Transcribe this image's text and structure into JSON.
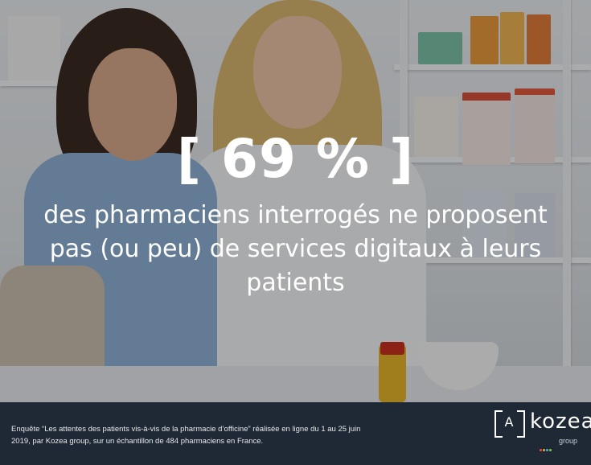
{
  "headline": {
    "stat": "[ 69 % ]",
    "line1": "des pharmaciens interrogés ne proposent",
    "line2": "pas (ou peu) de services digitaux à leurs",
    "line3": "patients"
  },
  "footer": {
    "note_line1": "Enquête “Les attentes des patients vis-à-vis de la pharmacie d’officine” réalisée en ligne du 1 au 25 juin",
    "note_line2": "2019, par Kozea group, sur un échantillon de 484 pharmaciens en France."
  },
  "logo": {
    "letter": "A",
    "word": "kozea",
    "sub": "group",
    "dot_colors": [
      "#e94e3c",
      "#f3a833",
      "#3fb6e0",
      "#8cc63f"
    ]
  }
}
